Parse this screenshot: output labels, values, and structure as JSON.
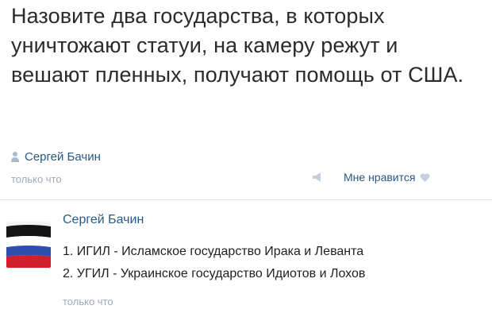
{
  "post": {
    "text": "Назовите два государства, в которых уничтожают статуи, на камеру режут и вешают пленных, получают помощь от США.",
    "author": "Сергей Бачин",
    "time": "только что",
    "like_label": "Мне нравится",
    "author_icon": "person-icon",
    "like_icon": "megaphone-icon",
    "heart_icon": "heart-icon"
  },
  "comment": {
    "author": "Сергей Бачин",
    "lines": [
      "1. ИГИЛ - Исламское государство Ирака и Леванта",
      "2. УГИЛ - Украинское государство Идиотов и Лохов"
    ],
    "time": "только что",
    "avatar": "russian-flag-avatar"
  },
  "colors": {
    "link": "#2a5885",
    "meta": "#a2a9b2",
    "text": "#2b2b2b",
    "divider": "#e2e5ea"
  }
}
